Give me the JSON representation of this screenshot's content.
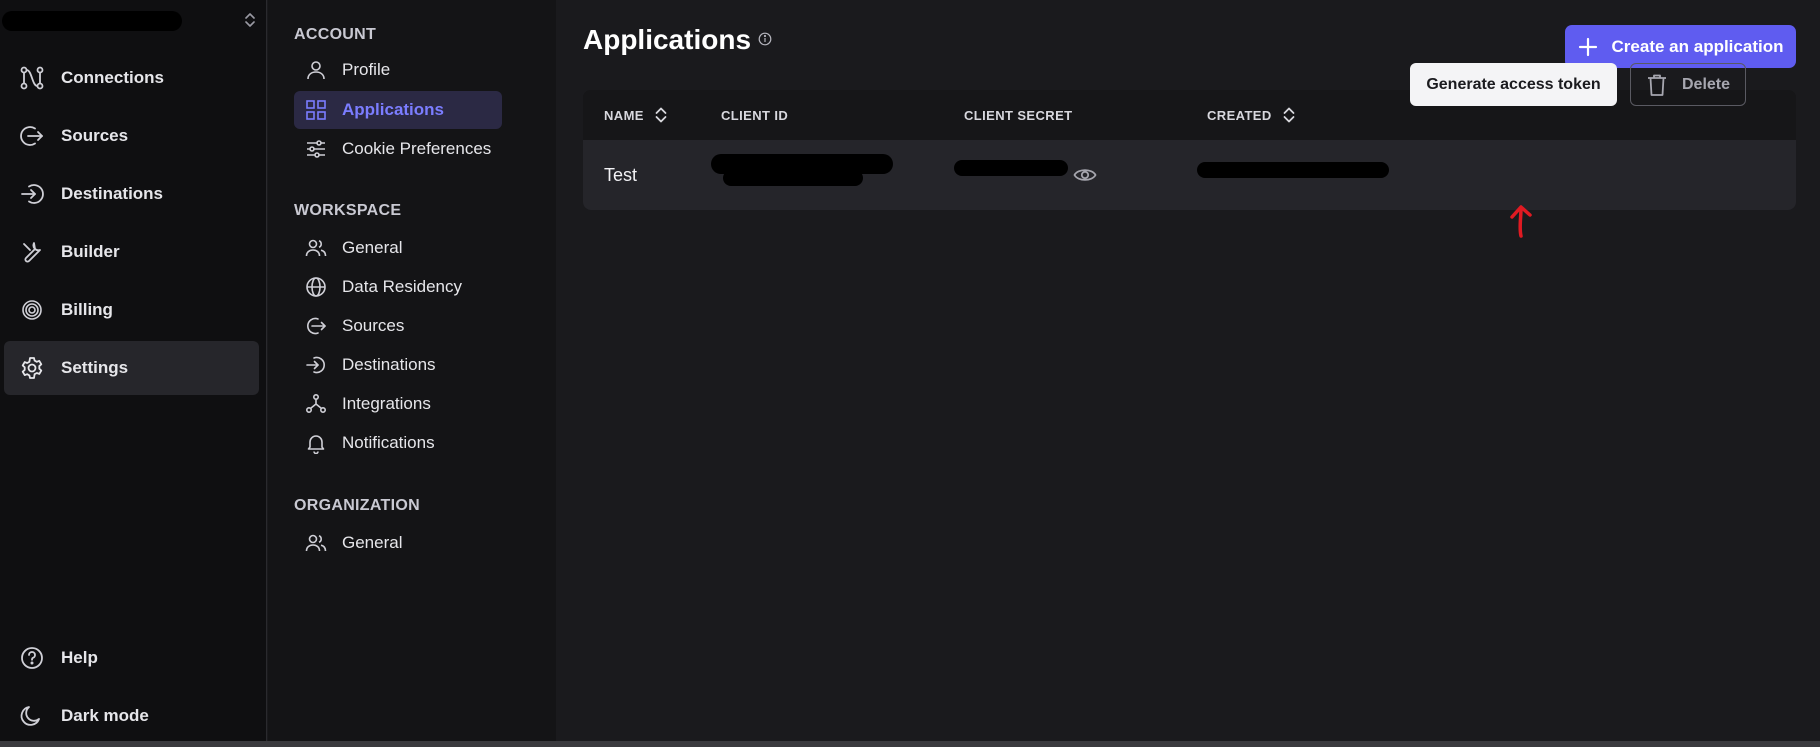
{
  "left_nav": {
    "items": [
      {
        "label": "Connections",
        "icon": "connections-icon"
      },
      {
        "label": "Sources",
        "icon": "sources-icon"
      },
      {
        "label": "Destinations",
        "icon": "destinations-icon"
      },
      {
        "label": "Builder",
        "icon": "builder-icon"
      },
      {
        "label": "Billing",
        "icon": "billing-icon"
      },
      {
        "label": "Settings",
        "icon": "gear-icon",
        "active": true
      }
    ],
    "bottom_items": [
      {
        "label": "Help",
        "icon": "help-icon"
      },
      {
        "label": "Dark mode",
        "icon": "moon-icon"
      }
    ]
  },
  "settings_nav": {
    "account": {
      "heading": "ACCOUNT",
      "items": [
        {
          "label": "Profile",
          "icon": "user-icon"
        },
        {
          "label": "Applications",
          "icon": "grid-icon",
          "active": true
        },
        {
          "label": "Cookie Preferences",
          "icon": "sliders-icon"
        }
      ]
    },
    "workspace": {
      "heading": "WORKSPACE",
      "items": [
        {
          "label": "General",
          "icon": "users-icon"
        },
        {
          "label": "Data Residency",
          "icon": "globe-icon"
        },
        {
          "label": "Sources",
          "icon": "sources-icon"
        },
        {
          "label": "Destinations",
          "icon": "destinations-icon"
        },
        {
          "label": "Integrations",
          "icon": "integrations-icon"
        },
        {
          "label": "Notifications",
          "icon": "bell-icon"
        }
      ]
    },
    "organization": {
      "heading": "ORGANIZATION",
      "items": [
        {
          "label": "General",
          "icon": "users-icon"
        }
      ]
    }
  },
  "main": {
    "title": "Applications",
    "create_button": "Create an application",
    "table": {
      "headers": {
        "name": "NAME",
        "client_id": "CLIENT ID",
        "client_secret": "CLIENT SECRET",
        "created": "CREATED"
      },
      "rows": [
        {
          "name": "Test"
        }
      ],
      "actions": {
        "generate": "Generate access token",
        "delete": "Delete"
      }
    }
  },
  "colors": {
    "accent": "#5f5cf0",
    "active_text": "#7b7dff",
    "annotation_arrow": "#e01a22"
  }
}
